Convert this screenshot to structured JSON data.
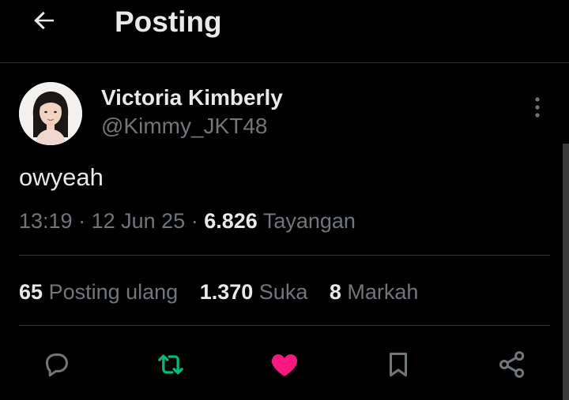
{
  "header": {
    "title": "Posting",
    "back_icon": "arrow-left-icon"
  },
  "author": {
    "display_name": "Victoria Kimberly",
    "handle": "@Kimmy_JKT48",
    "avatar": "profile-photo"
  },
  "post": {
    "text": "owyeah",
    "time": "13:19",
    "date": "12 Jun 25",
    "views_count": "6.826",
    "views_label": "Tayangan"
  },
  "stats": {
    "reposts_count": "65",
    "reposts_label": "Posting ulang",
    "likes_count": "1.370",
    "likes_label": "Suka",
    "bookmarks_count": "8",
    "bookmarks_label": "Markah"
  },
  "actions": {
    "reply_icon": "reply-icon",
    "repost_icon": "repost-icon",
    "like_icon": "heart-icon",
    "bookmark_icon": "bookmark-icon",
    "share_icon": "share-icon"
  },
  "colors": {
    "background": "#000000",
    "text_primary": "#e7e9ea",
    "text_secondary": "#71767b",
    "divider": "#2f3336",
    "repost_active": "#00ba7c",
    "like_active": "#f91880"
  }
}
